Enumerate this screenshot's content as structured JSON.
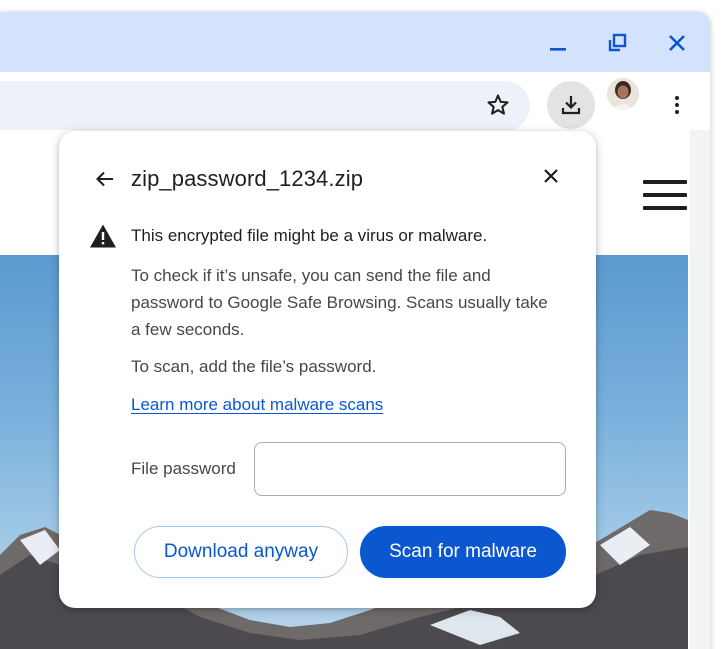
{
  "colors": {
    "titlebar": "#d3e3fd",
    "accent": "#0b57d0",
    "omnibox": "#edf2fa",
    "sky": "#79b0dc"
  },
  "window_controls": {
    "minimize_icon": "minimize-icon",
    "restore_icon": "restore-icon",
    "close_icon": "close-icon"
  },
  "toolbar": {
    "bookmark_icon": "star-icon",
    "downloads_icon": "download-icon",
    "menu_icon": "more-vert-icon"
  },
  "dialog": {
    "title": "zip_password_1234.zip",
    "warning": "This encrypted file might be a virus or malware.",
    "explanation": "To check if it’s unsafe, you can send the file and password to Google Safe Browsing. Scans usually take a few seconds.",
    "instruction": "To scan, add the file’s password.",
    "learn_more": "Learn more about malware scans",
    "password_label": "File password",
    "password_value": "",
    "download_anyway": "Download anyway",
    "scan": "Scan for malware"
  }
}
